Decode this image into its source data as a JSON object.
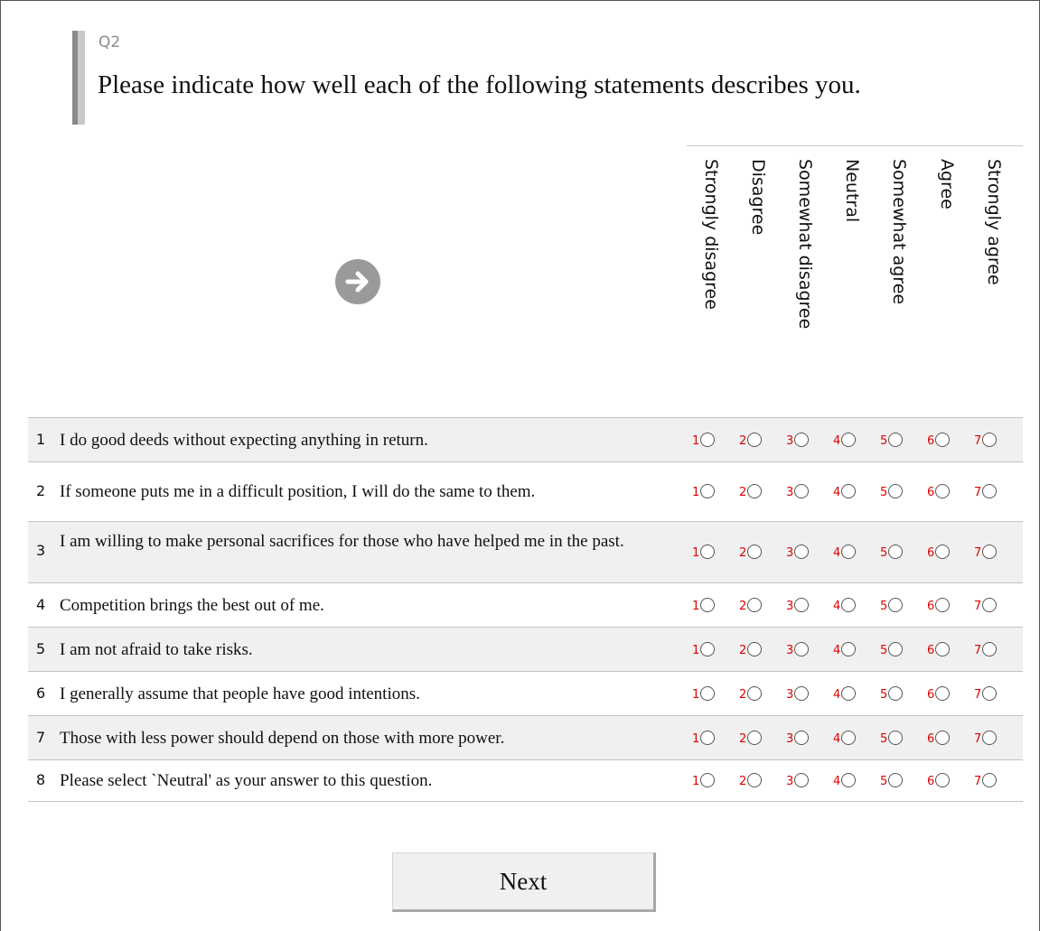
{
  "question": {
    "number": "Q2",
    "text": "Please indicate how well each of the following statements describes you."
  },
  "scale_labels": [
    "Strongly disagree",
    "Disagree",
    "Somewhat disagree",
    "Neutral",
    "Somewhat agree",
    "Agree",
    "Strongly agree"
  ],
  "option_numbers": [
    "1",
    "2",
    "3",
    "4",
    "5",
    "6",
    "7"
  ],
  "statements": [
    {
      "num": "1",
      "text": "I do good deeds without expecting anything in return."
    },
    {
      "num": "2",
      "text": "If someone puts me in a difficult position, I will do the same to them."
    },
    {
      "num": "3",
      "text": "I am willing to make personal sacrifices for those who have helped me in the past."
    },
    {
      "num": "4",
      "text": "Competition brings the best out of me."
    },
    {
      "num": "5",
      "text": "I am not afraid to take risks."
    },
    {
      "num": "6",
      "text": "I generally assume that people have good intentions."
    },
    {
      "num": "7",
      "text": "Those with less power should depend on those with more power."
    },
    {
      "num": "8",
      "text": "Please select `Neutral' as your answer to this question."
    }
  ],
  "next_button_label": "Next",
  "icons": {
    "navigation": "arrow-right-icon"
  }
}
